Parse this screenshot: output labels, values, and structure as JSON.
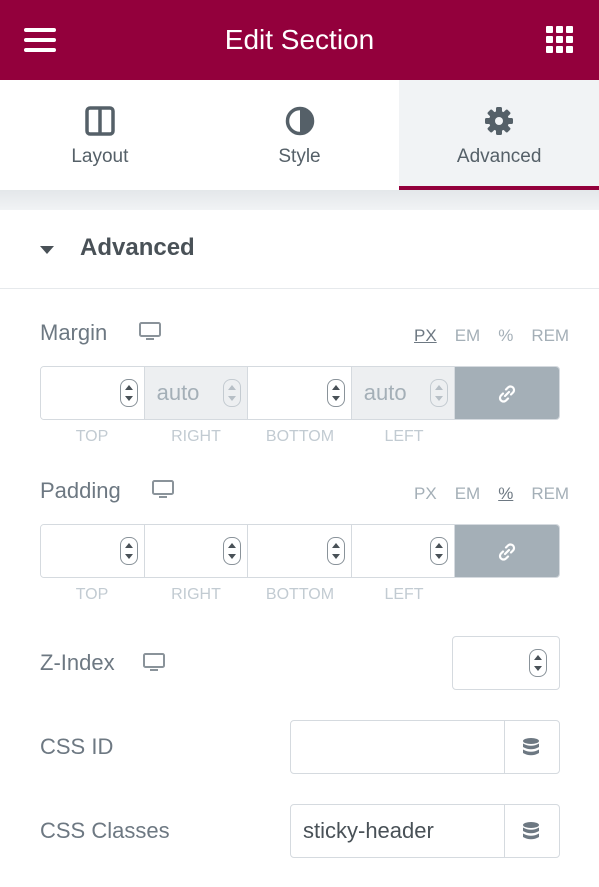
{
  "header": {
    "title": "Edit Section",
    "menu_icon": "hamburger-icon",
    "apps_icon": "grid-icon"
  },
  "tabs": [
    {
      "label": "Layout",
      "icon": "columns-icon"
    },
    {
      "label": "Style",
      "icon": "half-circle-icon"
    },
    {
      "label": "Advanced",
      "icon": "gear-icon",
      "active": true
    }
  ],
  "section": {
    "title": "Advanced"
  },
  "margin": {
    "label": "Margin",
    "units": [
      "PX",
      "EM",
      "%",
      "REM"
    ],
    "selected_unit": "PX",
    "fields": [
      {
        "label": "TOP",
        "value": ""
      },
      {
        "label": "RIGHT",
        "value": "auto"
      },
      {
        "label": "BOTTOM",
        "value": ""
      },
      {
        "label": "LEFT",
        "value": "auto"
      }
    ]
  },
  "padding": {
    "label": "Padding",
    "units": [
      "PX",
      "EM",
      "%",
      "REM"
    ],
    "selected_unit": "%",
    "fields": [
      {
        "label": "TOP",
        "value": ""
      },
      {
        "label": "RIGHT",
        "value": ""
      },
      {
        "label": "BOTTOM",
        "value": ""
      },
      {
        "label": "LEFT",
        "value": ""
      }
    ]
  },
  "z_index": {
    "label": "Z-Index",
    "value": ""
  },
  "css_id": {
    "label": "CSS ID",
    "value": ""
  },
  "css_classes": {
    "label": "CSS Classes",
    "value": "sticky-header"
  },
  "colors": {
    "brand": "#93003c",
    "link_button": "#a4afb7"
  }
}
